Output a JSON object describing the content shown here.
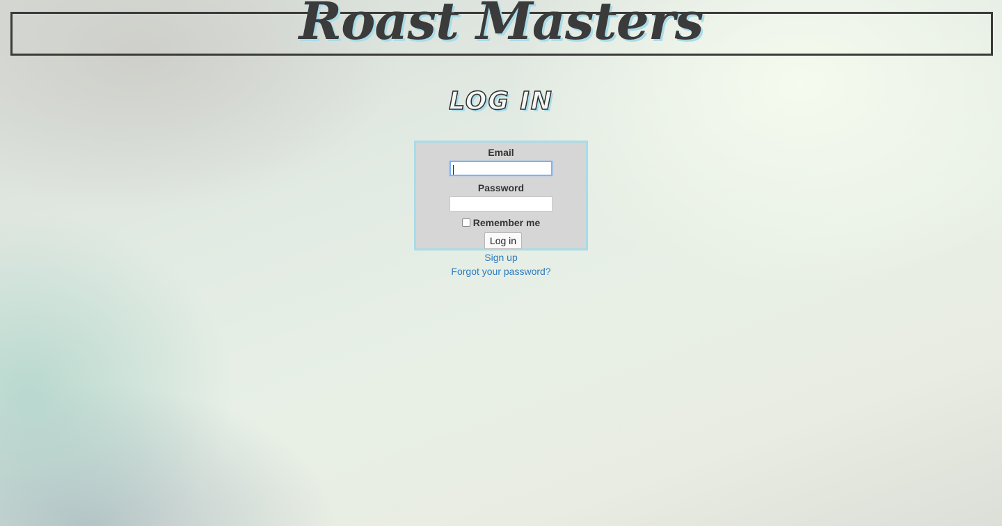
{
  "header": {
    "logo_text": "Roast Masters"
  },
  "page": {
    "heading": "LOG IN"
  },
  "login_form": {
    "email_label": "Email",
    "email_value": "",
    "password_label": "Password",
    "password_value": "",
    "remember_label": "Remember me",
    "remember_checked": false,
    "submit_label": "Log in"
  },
  "links": {
    "sign_up": "Sign up",
    "forgot_password": "Forgot your password?"
  },
  "colors": {
    "accent_border": "#a9dbe8",
    "link": "#2e7bbf",
    "form_background": "#d6d6d6",
    "header_border": "#3a3a3a"
  }
}
